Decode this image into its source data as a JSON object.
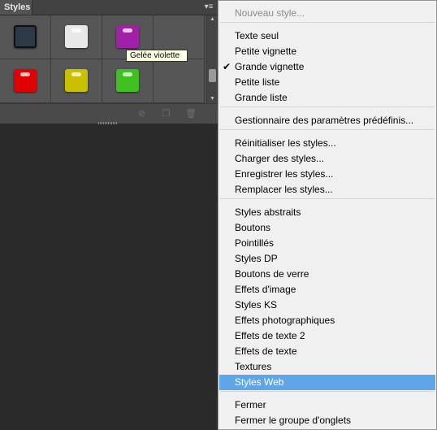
{
  "panel": {
    "tab_label": "Styles",
    "menu_icon": "panel-menu-icon",
    "swatches": [
      {
        "name": "Dark blue bevel",
        "color": "#2b3a44",
        "dark": true
      },
      {
        "name": "White gel",
        "color": "#e8e8e8",
        "dark": false
      },
      {
        "name": "Violet gel",
        "color": "#a020a8",
        "dark": false
      },
      {
        "name": "Red gel",
        "color": "#e00000",
        "dark": false
      },
      {
        "name": "Yellow gel",
        "color": "#c8c000",
        "dark": false
      },
      {
        "name": "Green gel",
        "color": "#40c020",
        "dark": false
      }
    ],
    "tooltip": "Gelée violette",
    "bottom_icons": [
      "no-style-icon",
      "new-style-icon",
      "delete-icon"
    ]
  },
  "menu": {
    "items": [
      {
        "label": "Nouveau style...",
        "disabled": true
      },
      {
        "label": "Texte seul"
      },
      {
        "label": "Petite vignette"
      },
      {
        "label": "Grande vignette",
        "checked": true
      },
      {
        "label": "Petite liste"
      },
      {
        "label": "Grande liste"
      },
      {
        "label": "Gestionnaire des paramètres prédéfinis..."
      },
      {
        "label": "Réinitialiser les styles..."
      },
      {
        "label": "Charger des styles..."
      },
      {
        "label": "Enregistrer les styles..."
      },
      {
        "label": "Remplacer les styles..."
      },
      {
        "label": "Styles abstraits"
      },
      {
        "label": "Boutons"
      },
      {
        "label": "Pointillés"
      },
      {
        "label": "Styles DP"
      },
      {
        "label": "Boutons de verre"
      },
      {
        "label": "Effets d'image"
      },
      {
        "label": "Styles KS"
      },
      {
        "label": "Effets photographiques"
      },
      {
        "label": "Effets de texte 2"
      },
      {
        "label": "Effets de texte"
      },
      {
        "label": "Textures"
      },
      {
        "label": "Styles Web",
        "highlighted": true
      },
      {
        "label": "Fermer"
      },
      {
        "label": "Fermer le groupe d'onglets"
      }
    ],
    "checkmark": "✔"
  },
  "colors": {
    "highlight": "#5ea6e8",
    "menu_bg": "#f0f0f0",
    "panel_bg": "#535353"
  }
}
